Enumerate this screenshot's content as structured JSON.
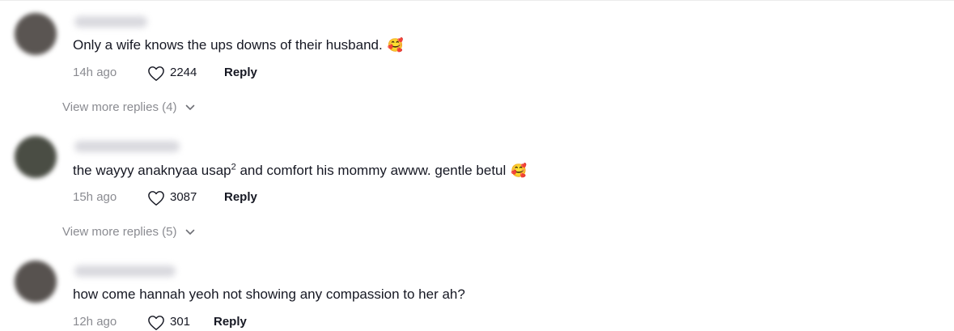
{
  "comments": [
    {
      "text": "Only a wife knows the ups downs of their husband.",
      "emoji": "🥰",
      "time": "14h ago",
      "likes": "2244",
      "reply_label": "Reply",
      "more_replies": "View more replies (4)"
    },
    {
      "text_before_sup": "the wayyy anaknyaa usap",
      "text_sup": "2",
      "text_after_sup": " and comfort his mommy awww. gentle betul",
      "emoji": "🥰",
      "time": "15h ago",
      "likes": "3087",
      "reply_label": "Reply",
      "more_replies": "View more replies (5)"
    },
    {
      "text": "how come hannah yeoh not showing any compassion to her ah?",
      "time": "12h ago",
      "likes": "301",
      "reply_label": "Reply"
    }
  ],
  "colors": {
    "text": "#161823",
    "muted": "#8a8b91",
    "avatar_1": "#5a5552",
    "avatar_2": "#4a4d44",
    "avatar_3": "#57524f"
  },
  "icons": {
    "like": "heart-outline-icon",
    "expand": "chevron-down-icon"
  }
}
